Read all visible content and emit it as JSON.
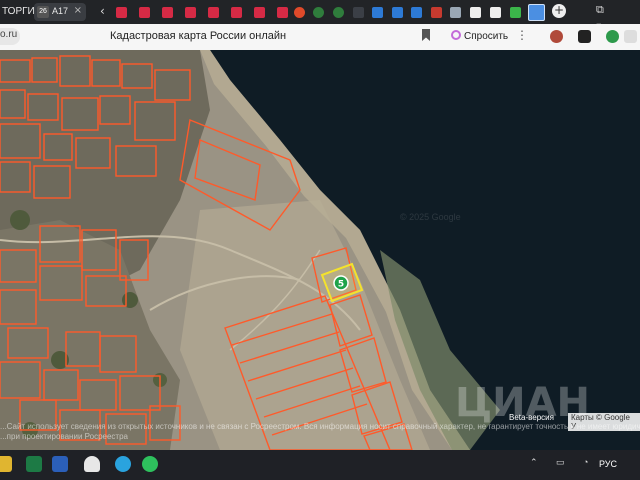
{
  "browser": {
    "tab_pinned_label": "ТОРГИ",
    "active_tab": {
      "badge": "26",
      "label": "A17",
      "close": "×"
    },
    "new_tab": "+",
    "address": {
      "url_fragment": "o.ru",
      "page_title": "Кадастровая карта России онлайн"
    },
    "ask_button_label": "Спросить",
    "more_menu": "⋮"
  },
  "map": {
    "beta_label": "Beta-версия",
    "copyright": "Карты © Google",
    "copyright_tail": "У",
    "parcel_marker_label": "5",
    "watermark": "ЦИАН",
    "faint_watermark": "© 2025 Google",
    "disclaimer_line1": "...Сайт использует сведения из открытых источников и не связан с Росреестром. Вся информация носит справочный характер, не гарантирует точность в не имеет юридической с",
    "disclaimer_line2": "...при проектировании Росреестра"
  },
  "taskbar": {
    "language": "РУС"
  },
  "colors": {
    "parcel_outline": "#ff5a2a",
    "selected_parcel": "#f4e22c",
    "marker": "#1fa34a",
    "water": "#0f1c25"
  }
}
